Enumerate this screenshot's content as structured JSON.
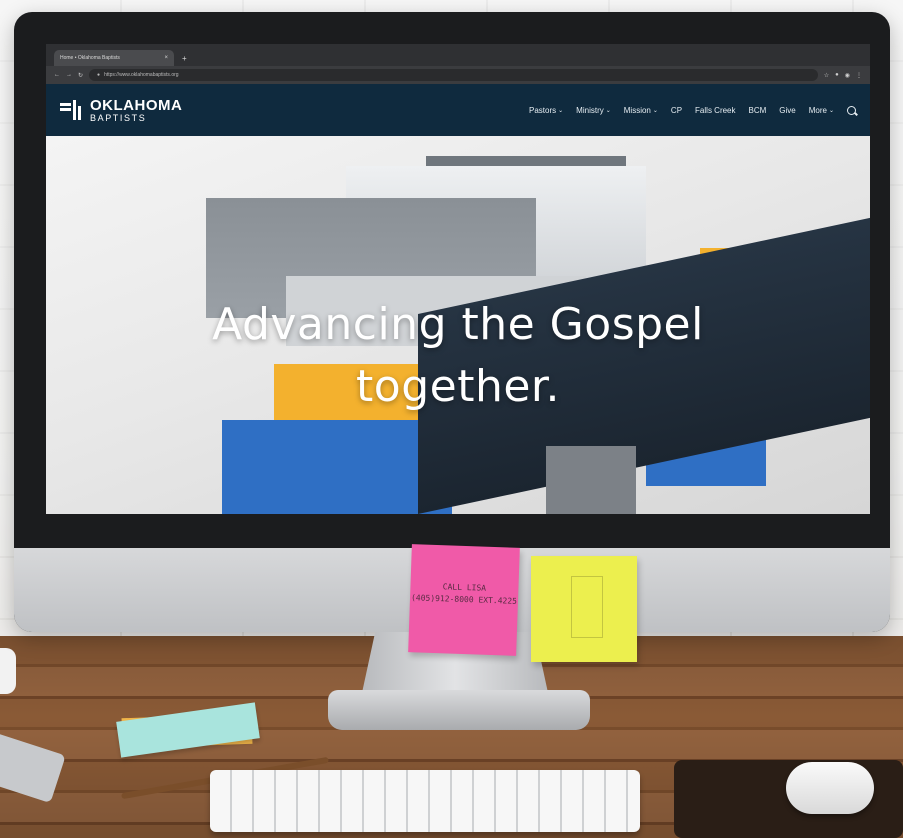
{
  "browser": {
    "tab_title": "Home • Oklahoma Baptists",
    "tab_close": "×",
    "new_tab": "+",
    "url": "https://www.oklahomabaptists.org"
  },
  "site": {
    "logo": {
      "line1": "OKLAHOMA",
      "line2": "BAPTISTS"
    },
    "menu": [
      {
        "label": "Pastors",
        "caret": "⌄"
      },
      {
        "label": "Ministry",
        "caret": "⌄"
      },
      {
        "label": "Mission",
        "caret": "⌄"
      },
      {
        "label": "CP",
        "caret": ""
      },
      {
        "label": "Falls Creek",
        "caret": ""
      },
      {
        "label": "BCM",
        "caret": ""
      },
      {
        "label": "Give",
        "caret": ""
      },
      {
        "label": "More",
        "caret": "⌄"
      }
    ]
  },
  "hero": {
    "line1": "Advancing the Gospel",
    "line2": "together."
  },
  "sticky_note": {
    "line1": "CALL LISA",
    "line2": "(405)912-8000 EXT.4225"
  },
  "colors": {
    "nav_bg": "#0f2a3e",
    "accent_orange": "#f3b12e",
    "accent_blue": "#2f6fc4",
    "sticky_pink": "#f05aa8",
    "sticky_yellow": "#ecef4e"
  }
}
